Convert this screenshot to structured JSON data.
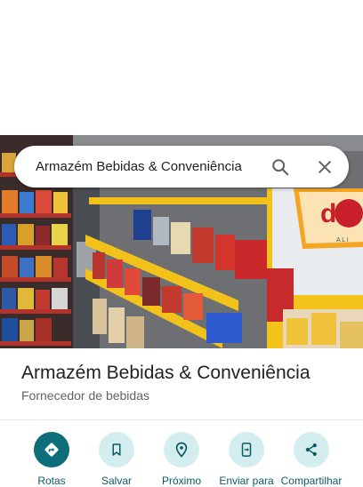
{
  "search": {
    "query": "Armazém Bebidas & Conveniência"
  },
  "place": {
    "name": "Armazém Bebidas & Conveniência",
    "category": "Fornecedor de bebidas"
  },
  "actions": [
    {
      "label": "Rotas",
      "icon": "directions-icon"
    },
    {
      "label": "Salvar",
      "icon": "bookmark-icon"
    },
    {
      "label": "Próximo",
      "icon": "nearby-icon"
    },
    {
      "label": "Enviar para",
      "icon": "send-to-phone-icon"
    },
    {
      "label": "Compartilhar",
      "icon": "share-icon"
    }
  ],
  "colors": {
    "accent": "#0b6e79",
    "action_bg": "#d4eef0",
    "label": "#0b5b64"
  }
}
